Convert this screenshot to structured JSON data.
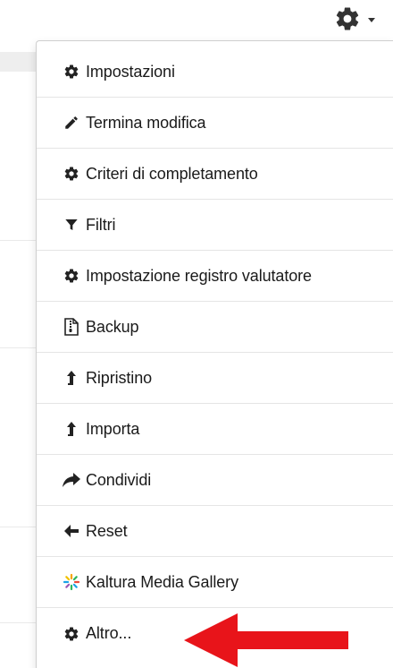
{
  "menu": {
    "items": [
      {
        "label": "Impostazioni",
        "icon": "gear-icon"
      },
      {
        "label": "Termina modifica",
        "icon": "pencil-icon"
      },
      {
        "label": "Criteri di completamento",
        "icon": "gear-icon"
      },
      {
        "label": "Filtri",
        "icon": "filter-icon"
      },
      {
        "label": "Impostazione registro valutatore",
        "icon": "gear-icon"
      },
      {
        "label": "Backup",
        "icon": "file-zip-icon"
      },
      {
        "label": "Ripristino",
        "icon": "upload-arrow-icon"
      },
      {
        "label": "Importa",
        "icon": "upload-arrow-icon"
      },
      {
        "label": "Condividi",
        "icon": "share-icon"
      },
      {
        "label": "Reset",
        "icon": "arrow-left-icon"
      },
      {
        "label": "Kaltura Media Gallery",
        "icon": "kaltura-icon"
      },
      {
        "label": "Altro...",
        "icon": "gear-icon"
      }
    ]
  },
  "colors": {
    "arrow": "#e8141a",
    "text": "#1a1a1a",
    "divider": "#e5e5e5"
  }
}
